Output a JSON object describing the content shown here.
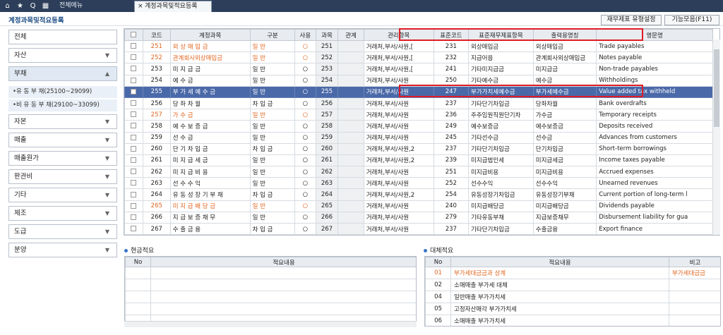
{
  "tabs": {
    "menu": "전체메뉴",
    "active": "계정과목및적요등록"
  },
  "header": {
    "title": "계정과목및적요등록",
    "btn1": "재무제표 유형설정",
    "btn2": "기능모음(F11)"
  },
  "sidebar": {
    "items": [
      "전체",
      "자산",
      "부채",
      "자본",
      "매출",
      "매출원가",
      "판관비",
      "기타",
      "제조",
      "도급",
      "분양"
    ],
    "sub": [
      "•유 동 부 채(25100~29099)",
      "•비 유 동 부 채(29100~33099)"
    ]
  },
  "grid": {
    "headers": [
      "",
      "코드",
      "계정과목",
      "구분",
      "사용",
      "과목",
      "관계",
      "관리항목",
      "표준코드",
      "표준재무제표항목",
      "출력용명칭",
      "영문명"
    ],
    "rows": [
      [
        "251",
        "외 상 매 입 금",
        "일 반",
        "○",
        "251",
        "",
        "거래처,부서/사원,[",
        "231",
        "외상매입금",
        "외상매입금",
        "Trade payables",
        "o"
      ],
      [
        "252",
        "관계회사외상매입금",
        "일 반",
        "○",
        "252",
        "",
        "거래처,부서/사원,[",
        "232",
        "지급어음",
        "관계회사외상매입금",
        "Notes payable",
        "o"
      ],
      [
        "253",
        "미 지 급 금",
        "일 반",
        "○",
        "253",
        "",
        "거래처,부서/사원,[",
        "241",
        "기타미지급금",
        "미지급금",
        "Non-trade payables",
        ""
      ],
      [
        "254",
        "예 수 금",
        "일 반",
        "○",
        "254",
        "",
        "거래처,부서/사원",
        "250",
        "기타예수금",
        "예수금",
        "Withholdings",
        ""
      ],
      [
        "255",
        "부 가 세 예 수 금",
        "일 반",
        "○",
        "255",
        "",
        "거래처,부서/사원",
        "247",
        "부가가치세예수금",
        "부가세예수금",
        "Value added tax withheld",
        "s"
      ],
      [
        "256",
        "당 좌 차 월",
        "차 입 금",
        "○",
        "256",
        "",
        "거래처,부서/사원",
        "237",
        "기타단기차입금",
        "당좌차월",
        "Bank overdrafts",
        ""
      ],
      [
        "257",
        "가 수 금",
        "일 반",
        "○",
        "257",
        "",
        "거래처,부서/사원",
        "236",
        "주주임원직원단기차",
        "가수금",
        "Temporary receipts",
        "o"
      ],
      [
        "258",
        "예 수 보 증 금",
        "일 반",
        "○",
        "258",
        "",
        "거래처,부서/사원",
        "249",
        "예수보증금",
        "예수보증금",
        "Deposits received",
        ""
      ],
      [
        "259",
        "선 수 금",
        "일 반",
        "○",
        "259",
        "",
        "거래처,부서/사원",
        "245",
        "기타선수금",
        "선수금",
        "Advances from customers",
        ""
      ],
      [
        "260",
        "단 기 차 입 금",
        "차 입 금",
        "○",
        "260",
        "",
        "거래처,부서/사원,2",
        "237",
        "기타단기차입금",
        "단기차입금",
        "Short-term borrowings",
        ""
      ],
      [
        "261",
        "미 지 급 세 금",
        "일 반",
        "○",
        "261",
        "",
        "거래처,부서/사원,2",
        "239",
        "미지급법인세",
        "미지급세금",
        "Income taxes payable",
        ""
      ],
      [
        "262",
        "미 지 급 비 용",
        "일 반",
        "○",
        "262",
        "",
        "거래처,부서/사원",
        "251",
        "미지급비용",
        "미지급비용",
        "Accrued expenses",
        ""
      ],
      [
        "263",
        "선 수 수 익",
        "일 반",
        "○",
        "263",
        "",
        "거래처,부서/사원",
        "252",
        "선수수익",
        "선수수익",
        "Unearned revenues",
        ""
      ],
      [
        "264",
        "유 동 성 장 기 부 채",
        "차 입 금",
        "○",
        "264",
        "",
        "거래처,부서/사원,2",
        "254",
        "유동성장기차입금",
        "유동성장기부채",
        "Current portion of long-term l",
        ""
      ],
      [
        "265",
        "미 지 급 배 당 금",
        "일 반",
        "○",
        "265",
        "",
        "거래처,부서/사원",
        "240",
        "미지급배당금",
        "미지급배당금",
        "Dividends payable",
        "o"
      ],
      [
        "266",
        "지 급 보 증 채 무",
        "일 반",
        "○",
        "266",
        "",
        "거래처,부서/사원",
        "279",
        "기타유동부채",
        "지급보증채무",
        "Disbursement liability for gua",
        ""
      ],
      [
        "267",
        "수 출 금 융",
        "차 입 금",
        "○",
        "267",
        "",
        "거래처,부서/사원",
        "237",
        "기타단기차입금",
        "수출금융",
        "Export finance",
        ""
      ]
    ]
  },
  "cash": {
    "title": "현금적요",
    "headers": [
      "No",
      "적요내용"
    ]
  },
  "transfer": {
    "title": "대체적요",
    "headers": [
      "No",
      "적요내용",
      "비고"
    ],
    "rows": [
      [
        "01",
        "부가세대금금과 상계",
        "부가세대금금"
      ],
      [
        "02",
        "소매매출 부가세 대체",
        ""
      ],
      [
        "04",
        "일반매출 부가가치세",
        ""
      ],
      [
        "05",
        "고정자산매각 부가가치세",
        ""
      ],
      [
        "06",
        "소매매출 부가가치세",
        ""
      ]
    ]
  },
  "colors": {
    "accent": "#1f4e86",
    "selected": "#4a69a8",
    "highlight": "#e01b24",
    "orange": "#e2651f"
  }
}
